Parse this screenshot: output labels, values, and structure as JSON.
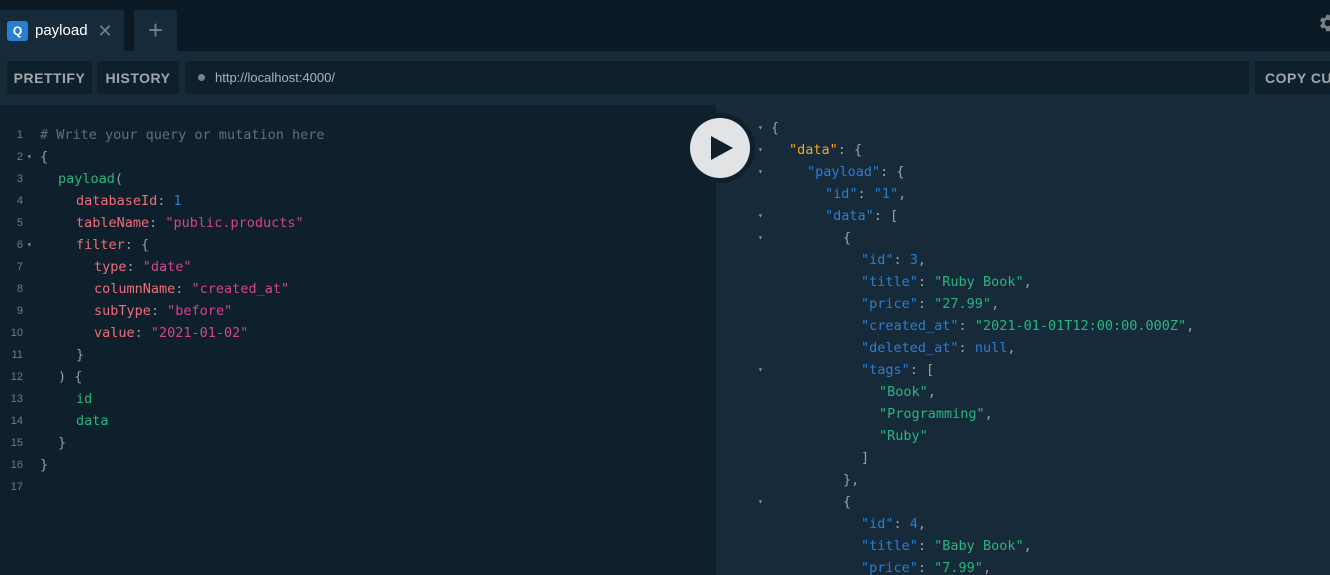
{
  "tabs": {
    "active": {
      "badge": "Q",
      "label": "payload",
      "close": "✕"
    },
    "add": "+"
  },
  "toolbar": {
    "prettify": "PRETTIFY",
    "history": "HISTORY",
    "url": "http://localhost:4000/",
    "copy": "COPY CURL"
  },
  "editor": {
    "line_numbers": [
      "1",
      "2",
      "3",
      "4",
      "5",
      "6",
      "7",
      "8",
      "9",
      "10",
      "11",
      "12",
      "13",
      "14",
      "15",
      "16",
      "17"
    ],
    "comment": "# Write your query or mutation here",
    "open_brace": "{",
    "query_name": "payload",
    "open_paren": "(",
    "args": [
      {
        "name": "databaseId",
        "value": "1",
        "kind": "num"
      },
      {
        "name": "tableName",
        "value": "\"public.products\"",
        "kind": "str"
      }
    ],
    "filter_name": "filter",
    "filter_args": [
      {
        "name": "type",
        "value": "\"date\""
      },
      {
        "name": "columnName",
        "value": "\"created_at\""
      },
      {
        "name": "subType",
        "value": "\"before\""
      },
      {
        "name": "value",
        "value": "\"2021-01-02\""
      }
    ],
    "close_filter": "}",
    "close_args": ") {",
    "fields": [
      "id",
      "data"
    ],
    "close_inner": "}",
    "close_outer": "}"
  },
  "result": {
    "lines": [
      {
        "indent": 0,
        "fold": true,
        "parts": [
          [
            "p",
            "{"
          ]
        ]
      },
      {
        "indent": 1,
        "fold": true,
        "parts": [
          [
            "kd",
            "\"data\""
          ],
          [
            "p",
            ": {"
          ]
        ]
      },
      {
        "indent": 2,
        "fold": true,
        "parts": [
          [
            "k",
            "\"payload\""
          ],
          [
            "p",
            ": {"
          ]
        ]
      },
      {
        "indent": 3,
        "fold": false,
        "parts": [
          [
            "k",
            "\"id\""
          ],
          [
            "p",
            ": "
          ],
          [
            "s",
            "\"1\""
          ],
          [
            "p",
            ","
          ]
        ]
      },
      {
        "indent": 3,
        "fold": true,
        "parts": [
          [
            "k",
            "\"data\""
          ],
          [
            "p",
            ": ["
          ]
        ]
      },
      {
        "indent": 4,
        "fold": true,
        "parts": [
          [
            "p",
            "{"
          ]
        ]
      },
      {
        "indent": 5,
        "fold": false,
        "parts": [
          [
            "k",
            "\"id\""
          ],
          [
            "p",
            ": "
          ],
          [
            "n",
            "3"
          ],
          [
            "p",
            ","
          ]
        ]
      },
      {
        "indent": 5,
        "fold": false,
        "parts": [
          [
            "k",
            "\"title\""
          ],
          [
            "p",
            ": "
          ],
          [
            "sv",
            "\"Ruby Book\""
          ],
          [
            "p",
            ","
          ]
        ]
      },
      {
        "indent": 5,
        "fold": false,
        "parts": [
          [
            "k",
            "\"price\""
          ],
          [
            "p",
            ": "
          ],
          [
            "sv",
            "\"27.99\""
          ],
          [
            "p",
            ","
          ]
        ]
      },
      {
        "indent": 5,
        "fold": false,
        "parts": [
          [
            "k",
            "\"created_at\""
          ],
          [
            "p",
            ": "
          ],
          [
            "sv",
            "\"2021-01-01T12:00:00.000Z\""
          ],
          [
            "p",
            ","
          ]
        ]
      },
      {
        "indent": 5,
        "fold": false,
        "parts": [
          [
            "k",
            "\"deleted_at\""
          ],
          [
            "p",
            ": "
          ],
          [
            "n",
            "null"
          ],
          [
            "p",
            ","
          ]
        ]
      },
      {
        "indent": 5,
        "fold": true,
        "parts": [
          [
            "k",
            "\"tags\""
          ],
          [
            "p",
            ": ["
          ]
        ]
      },
      {
        "indent": 6,
        "fold": false,
        "parts": [
          [
            "sv",
            "\"Book\""
          ],
          [
            "p",
            ","
          ]
        ]
      },
      {
        "indent": 6,
        "fold": false,
        "parts": [
          [
            "sv",
            "\"Programming\""
          ],
          [
            "p",
            ","
          ]
        ]
      },
      {
        "indent": 6,
        "fold": false,
        "parts": [
          [
            "sv",
            "\"Ruby\""
          ]
        ]
      },
      {
        "indent": 5,
        "fold": false,
        "parts": [
          [
            "p",
            "]"
          ]
        ]
      },
      {
        "indent": 4,
        "fold": false,
        "parts": [
          [
            "p",
            "},"
          ]
        ]
      },
      {
        "indent": 4,
        "fold": true,
        "parts": [
          [
            "p",
            "{"
          ]
        ]
      },
      {
        "indent": 5,
        "fold": false,
        "parts": [
          [
            "k",
            "\"id\""
          ],
          [
            "p",
            ": "
          ],
          [
            "n",
            "4"
          ],
          [
            "p",
            ","
          ]
        ]
      },
      {
        "indent": 5,
        "fold": false,
        "parts": [
          [
            "k",
            "\"title\""
          ],
          [
            "p",
            ": "
          ],
          [
            "sv",
            "\"Baby Book\""
          ],
          [
            "p",
            ","
          ]
        ]
      },
      {
        "indent": 5,
        "fold": false,
        "parts": [
          [
            "k",
            "\"price\""
          ],
          [
            "p",
            ": "
          ],
          [
            "sv",
            "\"7.99\""
          ],
          [
            "p",
            ","
          ]
        ]
      }
    ]
  }
}
